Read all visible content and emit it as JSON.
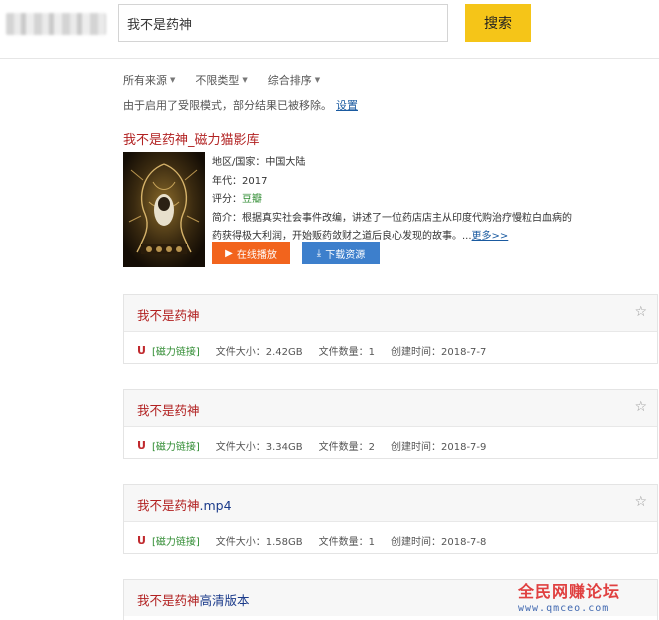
{
  "search": {
    "query": "我不是药神",
    "button_label": "搜索"
  },
  "filters": [
    {
      "label": "所有来源"
    },
    {
      "label": "不限类型"
    },
    {
      "label": "综合排序"
    }
  ],
  "notice": {
    "text": "由于启用了受限模式，部分结果已被移除。",
    "link_label": "设置"
  },
  "featured": {
    "title": "我不是药神_磁力猫影库",
    "region": "地区/国家：中国大陆",
    "year": "年代：2017",
    "rating_label": "评分：",
    "rating_value": "豆瓣",
    "summary_line1": "简介：根据真实社会事件改编，讲述了一位药店店主从印度代购治疗慢粒白血病的",
    "summary_line2": "药获得极大利润，开始贩药敛财之道后良心发现的故事。...",
    "more_label": "更多>>",
    "play_label": "在线播放",
    "download_label": "下载资源",
    "colors": {
      "play": "#f2641d",
      "download": "#3d7fcc"
    }
  },
  "results": [
    {
      "title_hl": "我不是药神",
      "title_rest": "",
      "link": "[磁力链接]",
      "size": "文件大小：2.42GB",
      "count": "文件数量：1",
      "created": "创建时间：2018-7-7"
    },
    {
      "title_hl": "我不是药神",
      "title_rest": "",
      "link": "[磁力链接]",
      "size": "文件大小：3.34GB",
      "count": "文件数量：2",
      "created": "创建时间：2018-7-9"
    },
    {
      "title_hl": "我不是药神",
      "title_rest": ".mp4",
      "link": "[磁力链接]",
      "size": "文件大小：1.58GB",
      "count": "文件数量：1",
      "created": "创建时间：2018-7-8"
    },
    {
      "title_hl": "我不是药神",
      "title_rest": "高清版本"
    }
  ],
  "watermark": {
    "name": "全民网赚论坛",
    "url": "www.qmceo.com"
  }
}
